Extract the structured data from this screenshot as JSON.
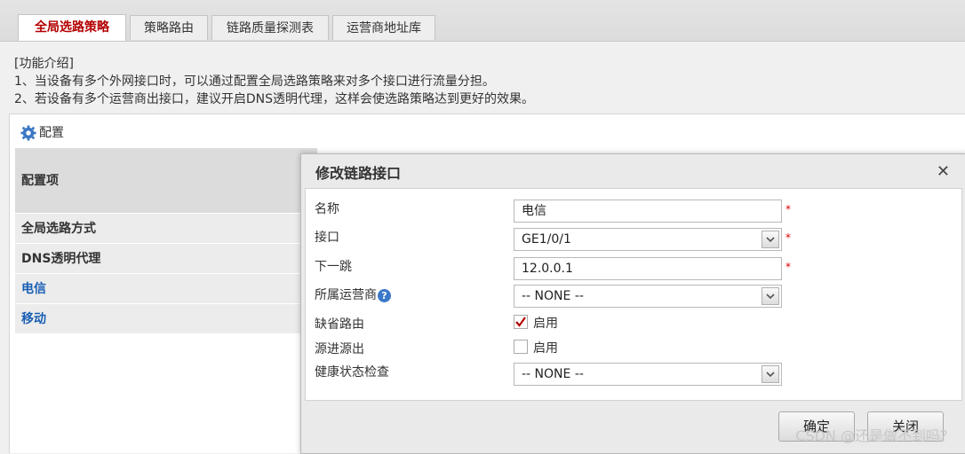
{
  "tabs": [
    {
      "label": "全局选路策略",
      "active": true
    },
    {
      "label": "策略路由",
      "active": false
    },
    {
      "label": "链路质量探测表",
      "active": false
    },
    {
      "label": "运营商地址库",
      "active": false
    }
  ],
  "intro": {
    "title": "[功能介绍]",
    "line1": "1、当设备有多个外网接口时，可以通过配置全局选路策略来对多个接口进行流量分担。",
    "line2": "2、若设备有多个运营商出接口，建议开启DNS透明代理，这样会使选路策略达到更好的效果。"
  },
  "panel": {
    "heading": "配置",
    "gear_icon": "gear-icon",
    "table_header": "配置项",
    "rows": [
      "全局选路方式",
      "DNS透明代理",
      "电信",
      "移动"
    ]
  },
  "dialog": {
    "title": "修改链路接口",
    "close_icon": "close-icon",
    "fields": {
      "name_label": "名称",
      "name_value": "电信",
      "interface_label": "接口",
      "interface_value": "GE1/0/1",
      "nexthop_label": "下一跳",
      "nexthop_value": "12.0.0.1",
      "isp_label": "所属运营商",
      "isp_value": "-- NONE --",
      "default_route_label": "缺省路由",
      "default_route_option": "启用",
      "default_route_checked": true,
      "src_label": "源进源出",
      "src_option": "启用",
      "src_checked": false,
      "health_label": "健康状态检查",
      "health_value": "-- NONE --"
    },
    "required_mark": "*",
    "help_mark": "?",
    "ok_label": "确定",
    "cancel_label": "关闭"
  },
  "watermark": "CSDN @还是做不到吗？",
  "colors": {
    "active_tab": "#b40000",
    "link": "#1a5fb4",
    "required": "#dd0000",
    "check": "#b40000"
  }
}
